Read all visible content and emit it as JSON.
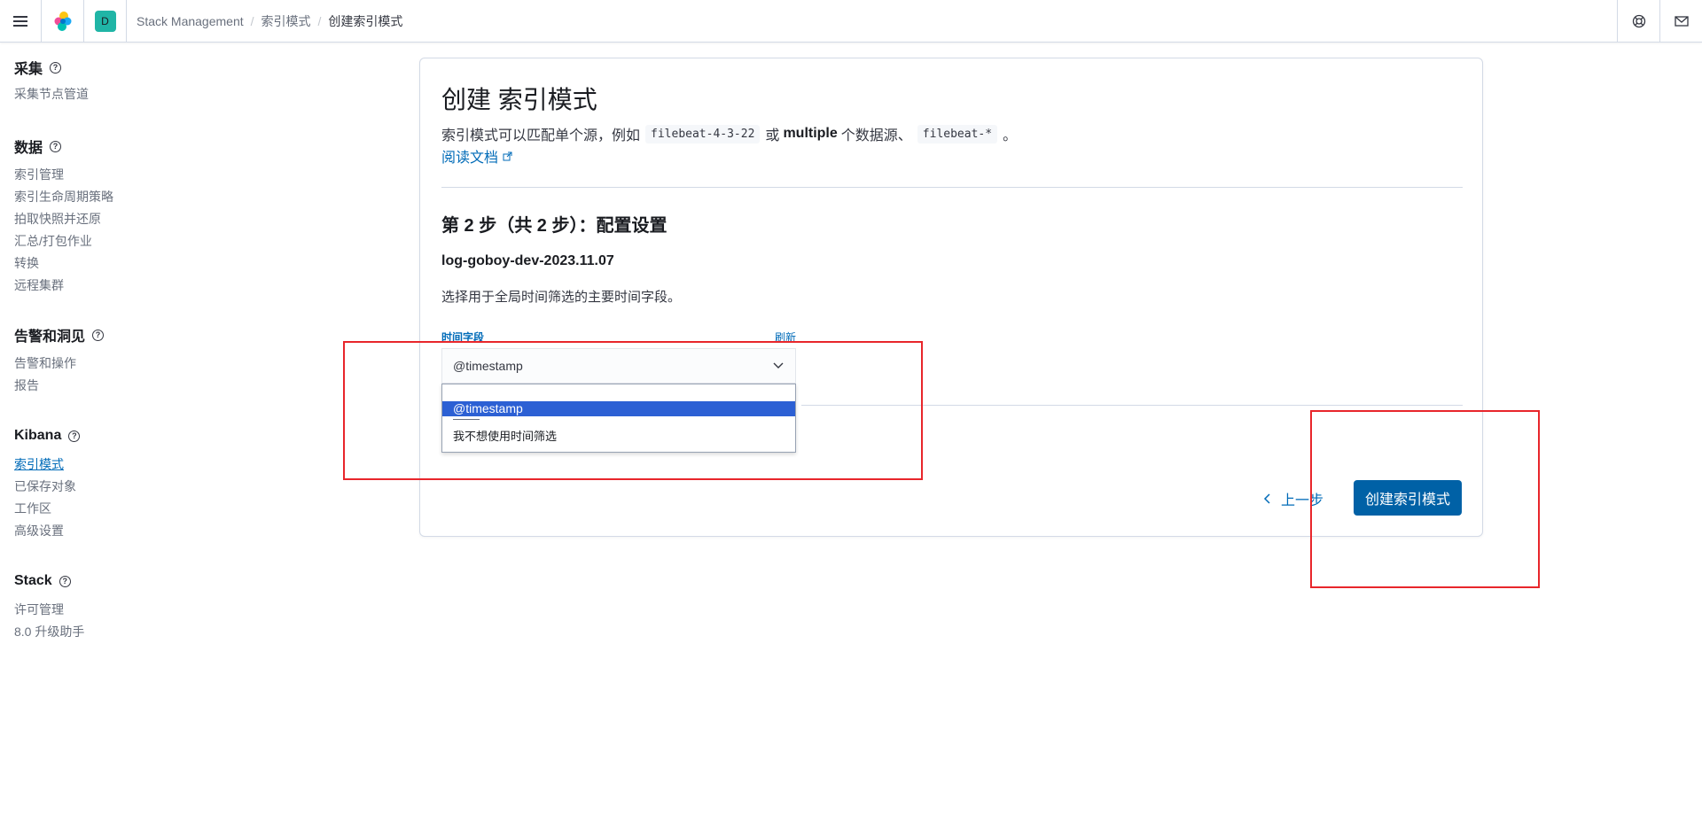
{
  "header": {
    "menu_icon": "hamburger-icon",
    "logo_icon": "elastic-logo-icon",
    "space_avatar": "D",
    "breadcrumbs": [
      "Stack Management",
      "索引模式",
      "创建索引模式"
    ],
    "right_icons": [
      "help-icon",
      "mail-icon"
    ],
    "accent_color": "#20b5a6"
  },
  "sidebar": {
    "groups": [
      {
        "title": "采集",
        "items": [
          "采集节点管道"
        ]
      },
      {
        "title": "数据",
        "items": [
          "索引管理",
          "索引生命周期策略",
          "拍取快照并还原",
          "汇总/打包作业",
          "转换",
          "远程集群"
        ]
      },
      {
        "title": "告警和洞见",
        "items": [
          "告警和操作",
          "报告"
        ]
      },
      {
        "title": "Kibana",
        "items": [
          "索引模式",
          "已保存对象",
          "工作区",
          "高级设置"
        ]
      },
      {
        "title": "Stack",
        "items": [
          "许可管理",
          "8.0 升级助手"
        ]
      }
    ],
    "active_item": "索引模式"
  },
  "main": {
    "title": "创建 索引模式",
    "desc_pre": "索引模式可以匹配单个源，例如",
    "code1": "filebeat-4-3-22",
    "desc_mid": "或",
    "desc_bold": "multiple",
    "desc_mid2": "个数据源、",
    "code2": "filebeat-*",
    "desc_end": "。",
    "doc_link": "阅读文档",
    "step_title": "第 2 步（共 2 步）：配置设置",
    "pattern_name": "log-goboy-dev-2023.11.07",
    "help_text": "选择用于全局时间筛选的主要时间字段。",
    "field_label": "时间字段",
    "refresh_label": "刷新",
    "select_value": "@timestamp",
    "dropdown_options": [
      "@timestamp",
      "我不想使用时间筛选"
    ],
    "dropdown_separator": "———",
    "back_label": "上一步",
    "create_label": "创建索引模式"
  },
  "colors": {
    "link": "#006bb8",
    "primary_button": "#0061a6",
    "selected_option": "#2c60d4",
    "annotation": "#e8262b"
  }
}
